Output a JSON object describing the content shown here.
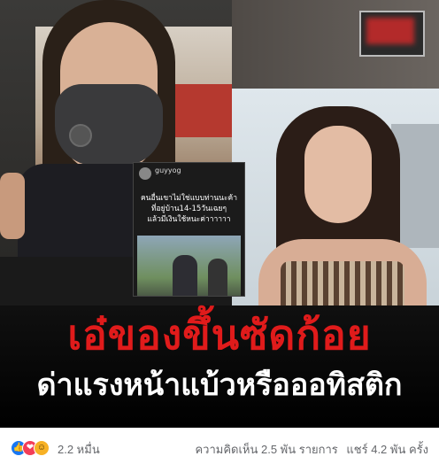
{
  "story": {
    "username": "guyyog",
    "text": "คนอื่นเขาไม่ใช่แบบท่านนะค้า\nที่อยู่บ้าน14-15วันเฉยๆ\nแล้วมีเงินใช้หนะค่าาาาาา"
  },
  "headline": {
    "line1": "เอ๋ของขึ้นซัดก้อย",
    "line2": "ด่าแรงหน้าแบ้วหรือออทิสติก"
  },
  "reactions": {
    "icons": [
      "like-icon",
      "love-icon",
      "haha-icon"
    ],
    "count": "2.2 หมื่น"
  },
  "stats": {
    "comments": "ความคิดเห็น 2.5 พัน รายการ",
    "shares": "แชร์ 4.2 พัน ครั้ง"
  },
  "colors": {
    "headline_red": "#e01b1b",
    "like_blue": "#1877f2",
    "love_red": "#f33e58",
    "haha_yellow": "#f7b125"
  }
}
